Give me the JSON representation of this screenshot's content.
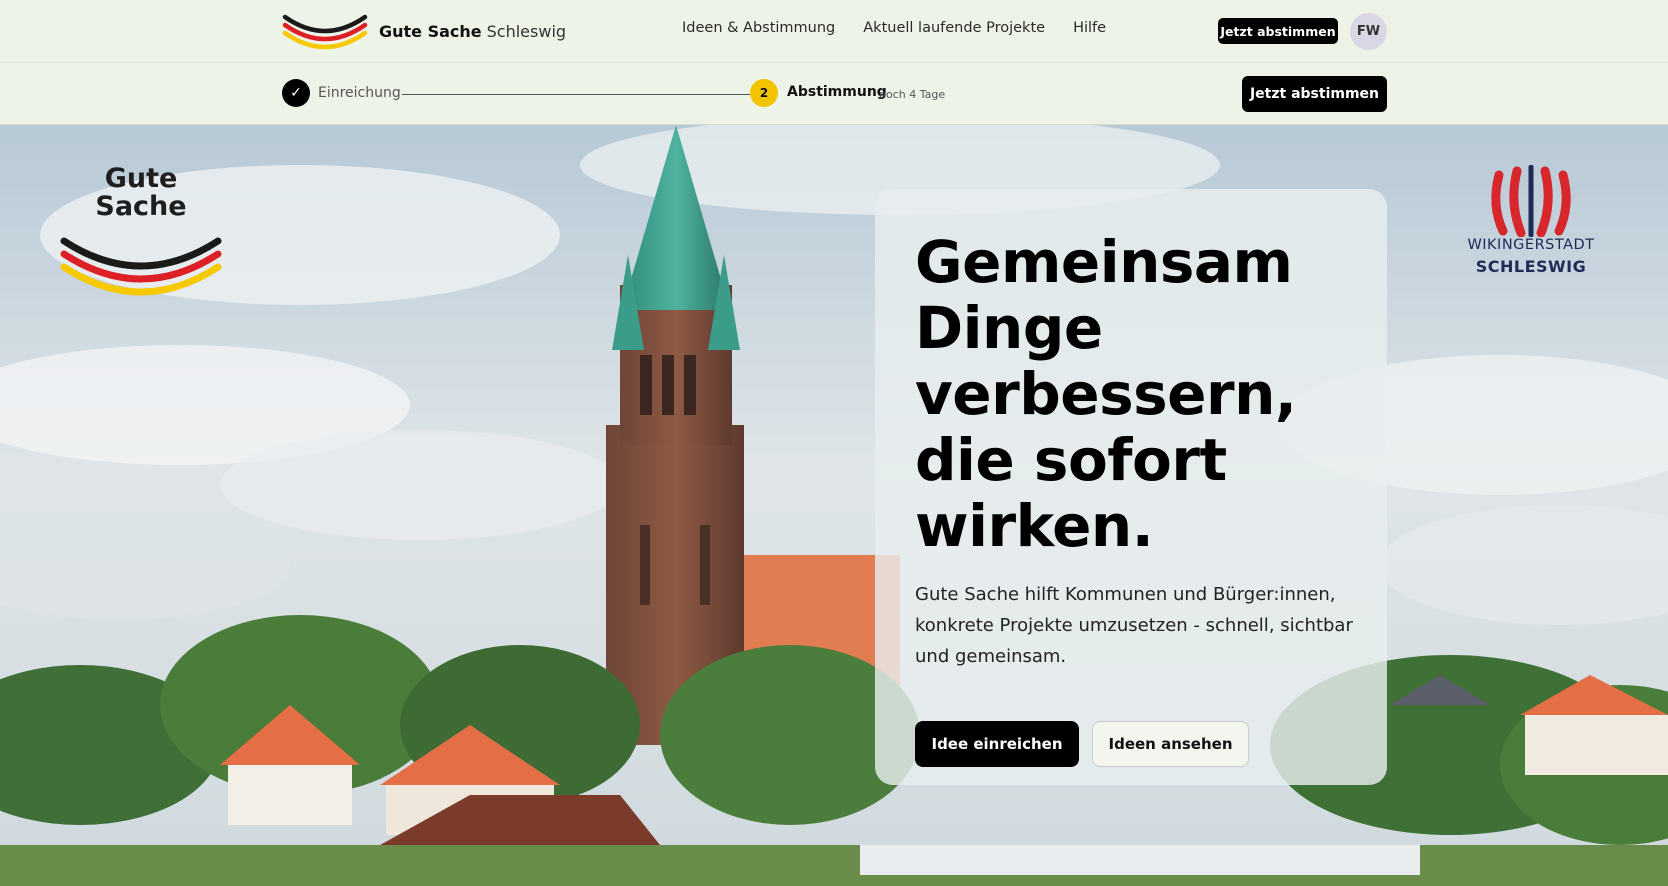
{
  "header": {
    "brand_bold": "Gute Sache",
    "brand_light": "Schleswig",
    "nav": [
      "Ideen & Abstimmung",
      "Aktuell laufende Projekte",
      "Hilfe"
    ],
    "cta_label": "Jetzt abstimmen",
    "avatar_initials": "FW"
  },
  "progress": {
    "step1": {
      "icon": "check-icon",
      "glyph": "✓",
      "label": "Einreichung"
    },
    "step2": {
      "number": "2",
      "label": "Abstimmung",
      "remaining": "noch 4 Tage"
    },
    "cta_label": "Jetzt abstimmen"
  },
  "hero": {
    "logo_left_line1": "Gute",
    "logo_left_line2": "Sache",
    "logo_right_line1": "WIKINGERSTADT",
    "logo_right_line2": "SCHLESWIG",
    "headline_lines": [
      "Gemeinsam",
      "Dinge",
      "verbessern,",
      "die sofort",
      "wirken."
    ],
    "subtext": "Gute Sache hilft Kommunen und Bürger:innen, konkrete Projekte umzusetzen - schnell, sichtbar und gemeinsam.",
    "primary_button": "Idee einreichen",
    "secondary_button": "Ideen ansehen"
  },
  "colors": {
    "flag_black": "#1a1a1a",
    "flag_red": "#dd1f26",
    "flag_gold": "#f6c800",
    "accent_yellow": "#f2c400",
    "ws_red": "#d7262c",
    "ws_blue": "#1f2a56"
  }
}
